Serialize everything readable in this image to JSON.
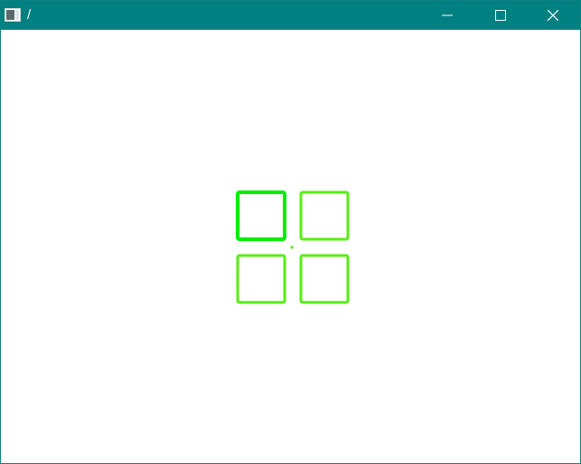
{
  "window": {
    "title": "/",
    "icon": "app-window-icon",
    "controls": {
      "minimize_icon": "minimize-icon",
      "maximize_icon": "maximize-icon",
      "close_icon": "close-icon"
    }
  },
  "colors": {
    "titlebar": "#008080",
    "titlebar_text": "#ffffff",
    "canvas_background": "#ffffff"
  },
  "canvas": {
    "tiles": [
      {
        "name": "tile-top-left",
        "color": "#00ee00",
        "stroke": 4
      },
      {
        "name": "tile-top-right",
        "color": "#55ee11",
        "stroke": 3
      },
      {
        "name": "tile-bottom-left",
        "color": "#55ee11",
        "stroke": 3
      },
      {
        "name": "tile-bottom-right",
        "color": "#55ee11",
        "stroke": 3
      }
    ],
    "center_dot_color": "#55ee11"
  }
}
